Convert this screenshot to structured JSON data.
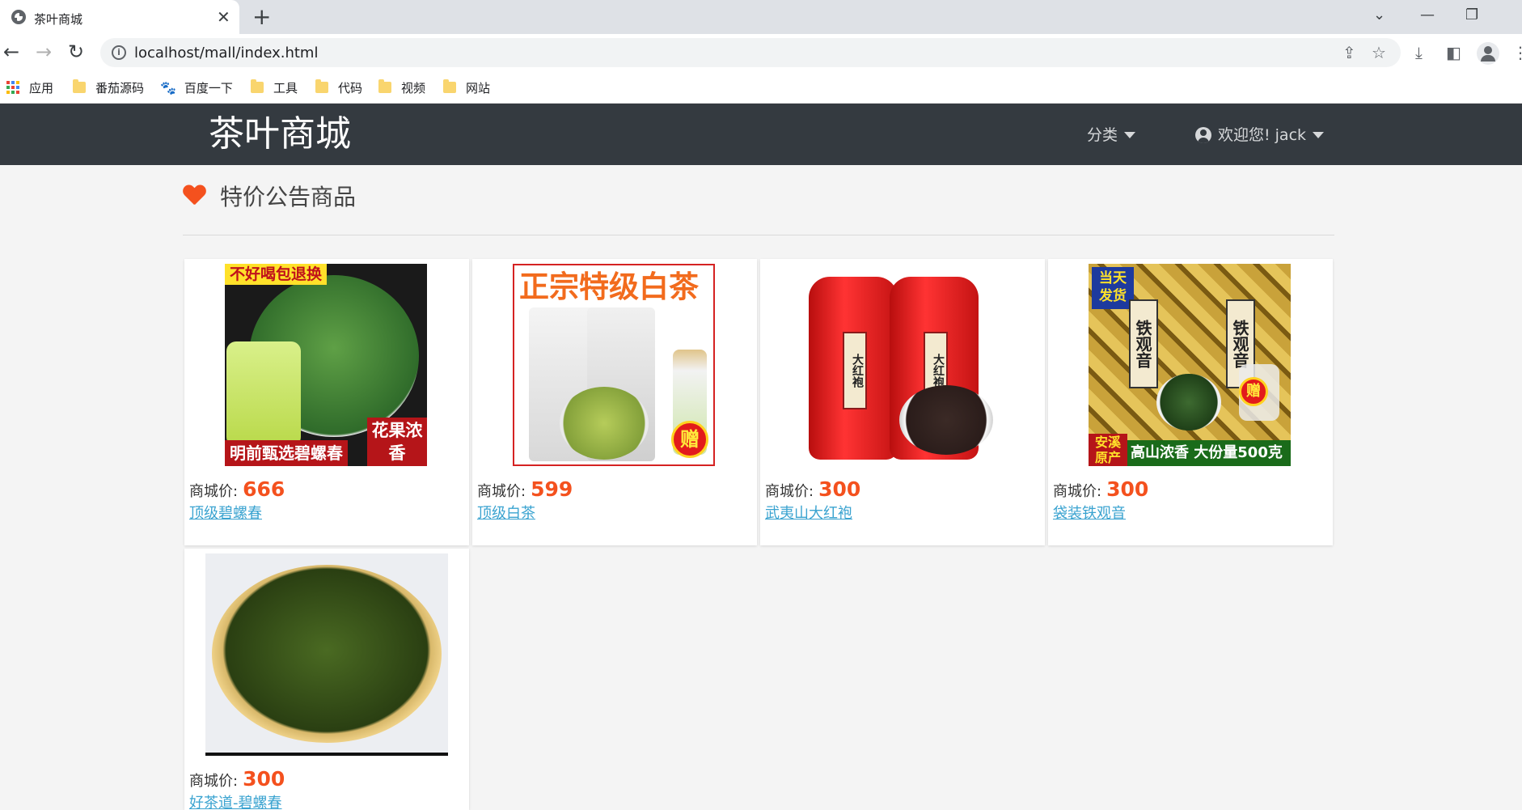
{
  "browser": {
    "tab_title": "茶叶商城",
    "url": "localhost/mall/index.html",
    "bookmarks": [
      "应用",
      "番茄源码",
      "百度一下",
      "工具",
      "代码",
      "视频",
      "网站"
    ]
  },
  "header": {
    "brand": "茶叶商城",
    "category_label": "分类",
    "user_label": "欢迎您! jack"
  },
  "section": {
    "title": "特价公告商品"
  },
  "price_prefix": "商城价:",
  "products": [
    {
      "name": "顶级碧螺春",
      "price": "666",
      "art": {
        "top_ribbon": "不好喝包退换",
        "bottom_ribbon": "明前甄选碧螺春",
        "corner_tag": "花果浓香"
      }
    },
    {
      "name": "顶级白茶",
      "price": "599",
      "art": {
        "headline": "正宗特级白茶",
        "gift": "赠"
      }
    },
    {
      "name": "武夷山大红袍",
      "price": "300",
      "art": {
        "can_label": "大红袍"
      }
    },
    {
      "name": "袋装铁观音",
      "price": "300",
      "art": {
        "badge": "当天发货",
        "label": "铁观音",
        "gift": "赠",
        "origin": "安溪原产",
        "footer": "高山浓香 大份量500克"
      }
    },
    {
      "name": "好茶道-碧螺春",
      "price": "300",
      "art": {}
    }
  ]
}
